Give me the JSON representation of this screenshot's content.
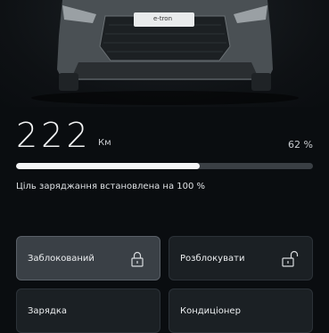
{
  "car": {
    "badge": "e-tron"
  },
  "range": {
    "value": "222",
    "unit": "Км"
  },
  "charge": {
    "percent_text": "62 %",
    "level": 0.62,
    "target_text": "Ціль заряджання встановлена на 100 %"
  },
  "controls": [
    {
      "label": "Заблокований",
      "icon": "lock-closed-icon",
      "active": true
    },
    {
      "label": "Розблокувати",
      "icon": "lock-open-icon",
      "active": false
    },
    {
      "label": "Зарядка",
      "active": false
    },
    {
      "label": "Кондиціонер",
      "active": false
    }
  ],
  "colors": {
    "background": "#0a0d10",
    "tile": "#1b2024",
    "tile_active": "#3a4046",
    "bar_fill": "#f4f5f6",
    "bar_track": "#3a3f44"
  }
}
